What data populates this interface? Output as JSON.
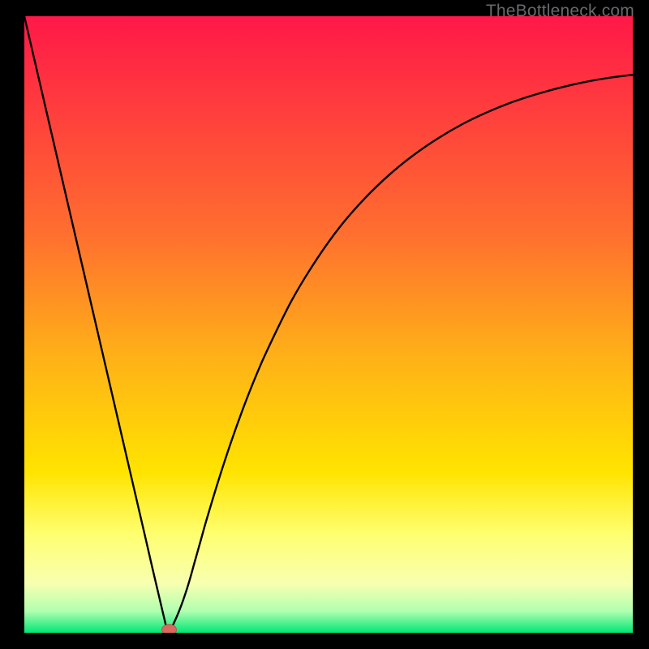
{
  "attribution": "TheBottleneck.com",
  "colors": {
    "bg": "#000000",
    "attribution": "#67696b",
    "curve": "#000000",
    "marker_fill": "#d96a5f",
    "marker_stroke": "#c85045",
    "gradient_top": "#ff1848",
    "gradient_35": "#ff6e2f",
    "gradient_55": "#ffb018",
    "gradient_72": "#ffe400",
    "gradient_band_top": "#ffff70",
    "gradient_band_mid": "#f8ffb0",
    "gradient_green_top": "#b0ffb0",
    "gradient_green": "#00e676"
  },
  "chart_data": {
    "type": "line",
    "title": "",
    "xlabel": "",
    "ylabel": "",
    "xlim": [
      0,
      100
    ],
    "ylim": [
      0,
      100
    ],
    "x": [
      0,
      2,
      4,
      6,
      8,
      10,
      12,
      14,
      16,
      18,
      20,
      21,
      22,
      23,
      23.5,
      24,
      25,
      26,
      27,
      28,
      29,
      30,
      32,
      34,
      36,
      38,
      40,
      44,
      48,
      52,
      56,
      60,
      64,
      68,
      72,
      76,
      80,
      84,
      88,
      92,
      96,
      100
    ],
    "values": [
      100,
      91.5,
      83,
      74.5,
      66,
      57.5,
      49,
      40.5,
      32,
      23.5,
      15,
      10.7,
      6.5,
      2.3,
      0.5,
      0.5,
      2.5,
      5.0,
      8.0,
      11.5,
      15.0,
      18.5,
      25.0,
      31.0,
      36.5,
      41.5,
      46.0,
      54.0,
      60.5,
      66.0,
      70.5,
      74.3,
      77.5,
      80.2,
      82.5,
      84.4,
      86.0,
      87.3,
      88.4,
      89.3,
      90.0,
      90.5
    ],
    "marker": {
      "x": 23.8,
      "y": 0.5
    }
  }
}
